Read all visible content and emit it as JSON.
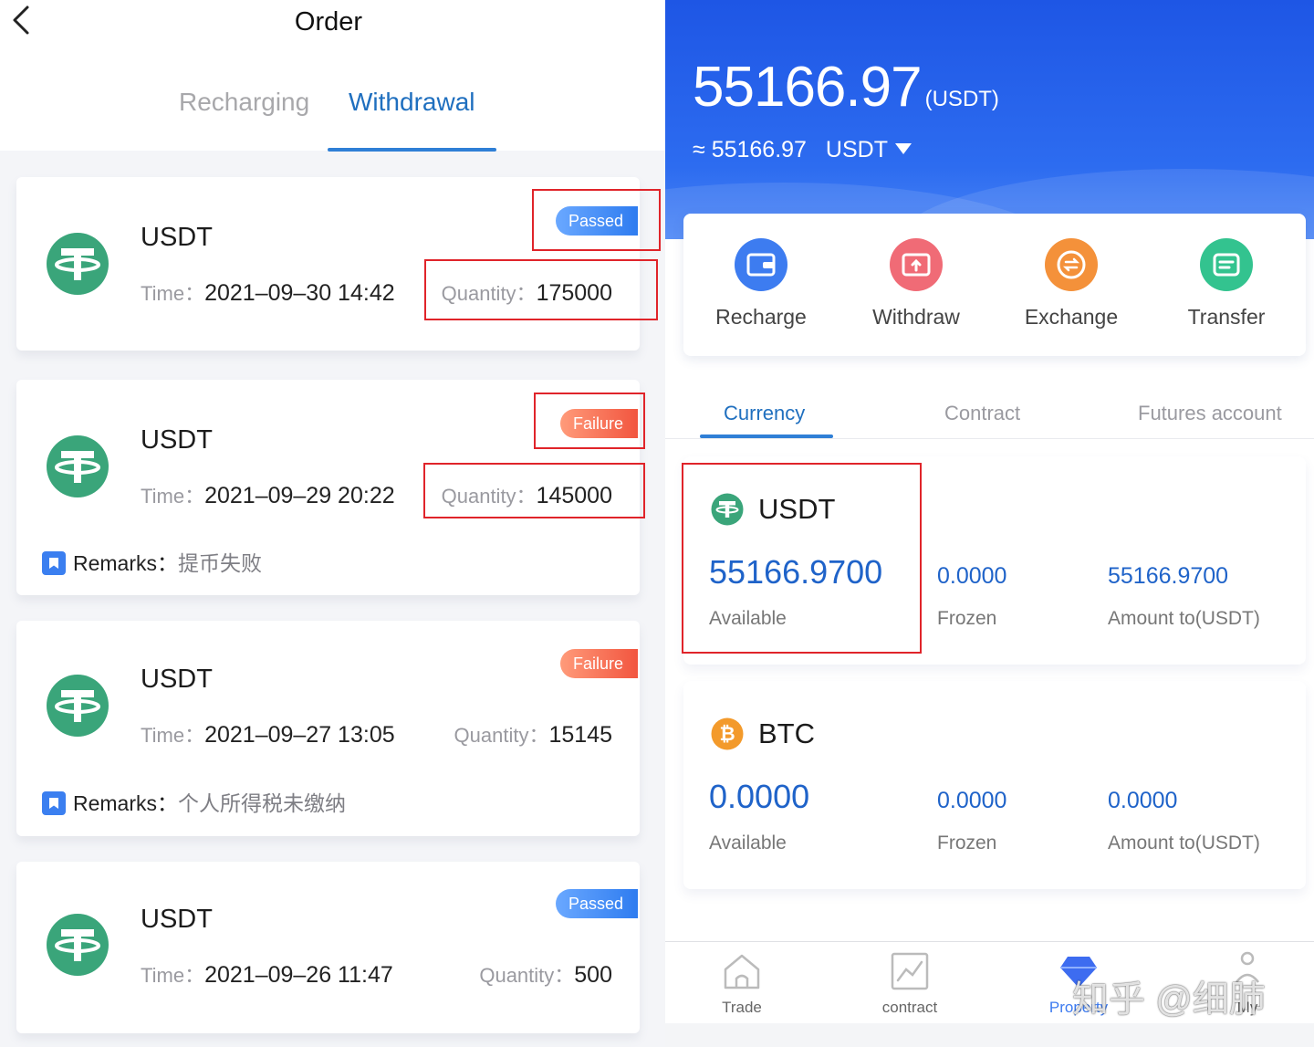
{
  "left": {
    "title": "Order",
    "tabs": [
      {
        "label": "Recharging",
        "active": false
      },
      {
        "label": "Withdrawal",
        "active": true
      }
    ],
    "time_label": "Time：",
    "quantity_label": "Quantity：",
    "remarks_label": "Remarks：",
    "orders": [
      {
        "coin": "USDT",
        "time": "2021–09–30 14:42",
        "quantity": "175000",
        "status": "Passed",
        "remarks": null
      },
      {
        "coin": "USDT",
        "time": "2021–09–29 20:22",
        "quantity": "145000",
        "status": "Failure",
        "remarks": "提币失败"
      },
      {
        "coin": "USDT",
        "time": "2021–09–27 13:05",
        "quantity": "15145",
        "status": "Failure",
        "remarks": "个人所得税未缴纳"
      },
      {
        "coin": "USDT",
        "time": "2021–09–26 11:47",
        "quantity": "500",
        "status": "Passed",
        "remarks": null
      }
    ]
  },
  "right": {
    "balance": "55166.97",
    "balance_unit": "(USDT)",
    "approx_prefix": "≈",
    "approx_value": "55166.97",
    "approx_currency": "USDT",
    "actions": [
      {
        "label": "Recharge",
        "icon": "wallet-icon"
      },
      {
        "label": "Withdraw",
        "icon": "withdraw-icon"
      },
      {
        "label": "Exchange",
        "icon": "exchange-icon"
      },
      {
        "label": "Transfer",
        "icon": "transfer-icon"
      }
    ],
    "account_tabs": [
      {
        "label": "Currency",
        "active": true
      },
      {
        "label": "Contract",
        "active": false
      },
      {
        "label": "Futures account",
        "active": false
      }
    ],
    "assets": [
      {
        "name": "USDT",
        "available": "55166.9700",
        "frozen": "0.0000",
        "amount": "55166.9700",
        "available_label": "Available",
        "frozen_label": "Frozen",
        "amount_label": "Amount to(USDT)"
      },
      {
        "name": "BTC",
        "available": "0.0000",
        "frozen": "0.0000",
        "amount": "0.0000",
        "available_label": "Available",
        "frozen_label": "Frozen",
        "amount_label": "Amount to(USDT)"
      }
    ],
    "nav": [
      {
        "label": "Trade",
        "active": false
      },
      {
        "label": "contract",
        "active": false
      },
      {
        "label": "Property",
        "active": true
      },
      {
        "label": "My",
        "active": false
      }
    ],
    "watermark": "知乎 @细肺"
  },
  "colors": {
    "accent_blue": "#2f7fd6",
    "passed_badge": "#2e7cf0",
    "failure_badge": "#f2553f",
    "tether_green": "#3aa57a",
    "hero_blue": "#1e56e5",
    "annotation_red": "#e0242a"
  }
}
